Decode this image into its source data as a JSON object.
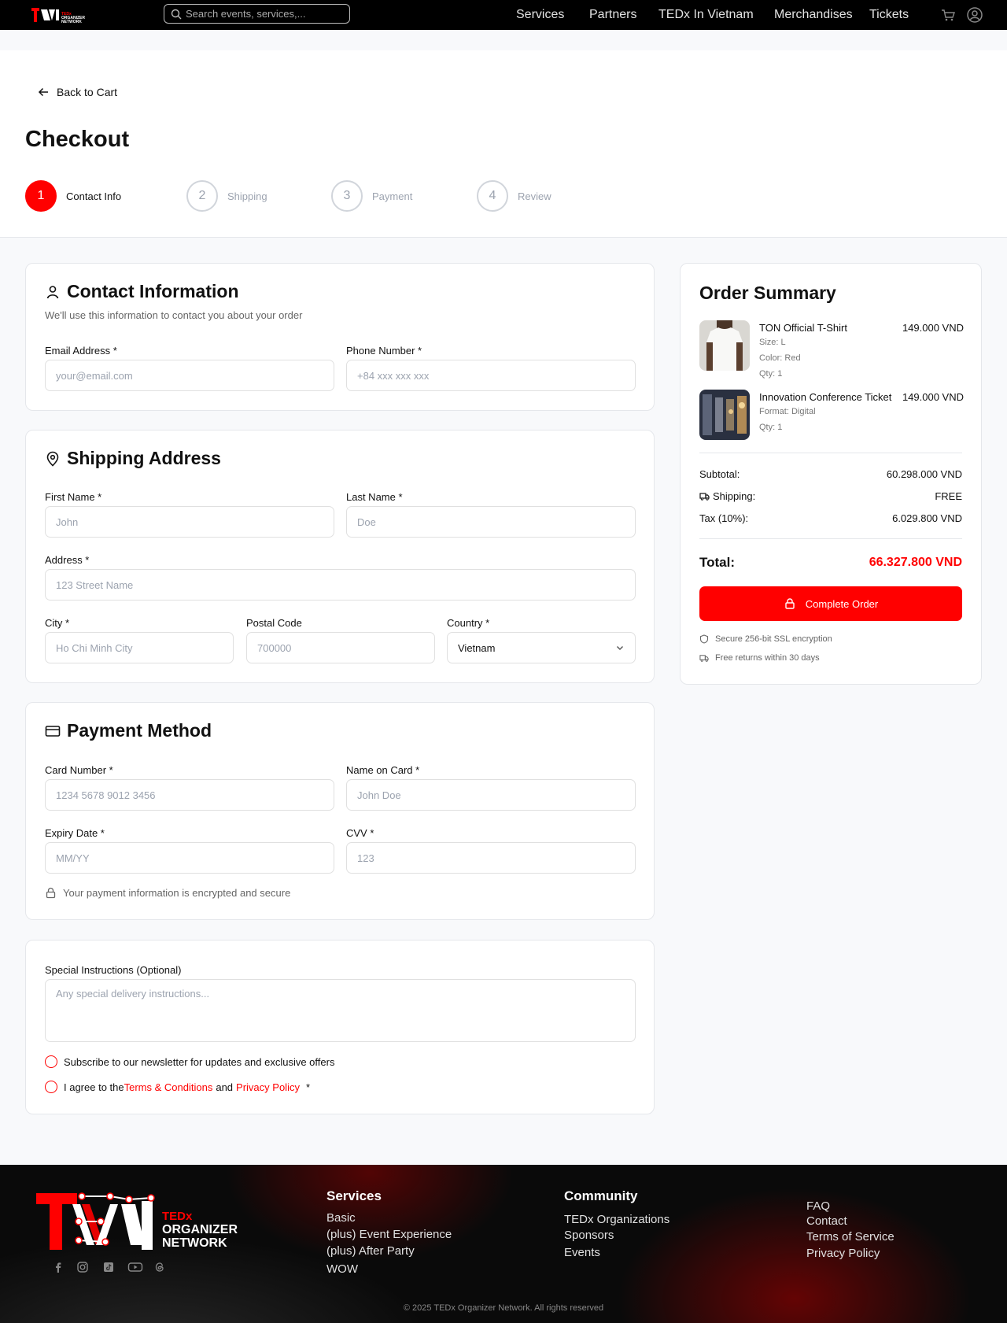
{
  "nav": {
    "logo_text": "TEDx ORGANIZER NETWORK",
    "search_placeholder": "Search events, services,...",
    "links": [
      "Services",
      "Partners",
      "TEDx In Vietnam",
      "Merchandises",
      "Tickets"
    ],
    "icons": [
      "cart-icon",
      "user-icon"
    ]
  },
  "header": {
    "back_label": "Back to Cart",
    "title": "Checkout",
    "steps": [
      {
        "num": "1",
        "label": "Contact Info",
        "active": true
      },
      {
        "num": "2",
        "label": "Shipping",
        "active": false
      },
      {
        "num": "3",
        "label": "Payment",
        "active": false
      },
      {
        "num": "4",
        "label": "Review",
        "active": false
      }
    ]
  },
  "contact": {
    "title": "Contact Information",
    "subtitle": "We'll use this information to contact you about your order",
    "email_label": "Email Address *",
    "email_placeholder": "your@email.com",
    "phone_label": "Phone Number *",
    "phone_placeholder": "+84 xxx xxx xxx"
  },
  "shipping": {
    "title": "Shipping Address",
    "first_label": "First Name *",
    "first_placeholder": "John",
    "last_label": "Last Name *",
    "last_placeholder": "Doe",
    "address_label": "Address *",
    "address_placeholder": "123 Street Name",
    "city_label": "City *",
    "city_placeholder": "Ho Chi Minh City",
    "postal_label": "Postal Code",
    "postal_placeholder": "700000",
    "country_label": "Country *",
    "country_value": "Vietnam"
  },
  "payment": {
    "title": "Payment Method",
    "card_label": "Card Number *",
    "card_placeholder": "1234 5678 9012 3456",
    "name_label": "Name on Card *",
    "name_placeholder": "John Doe",
    "expiry_label": "Expiry Date *",
    "expiry_placeholder": "MM/YY",
    "cvv_label": "CVV *",
    "cvv_placeholder": "123",
    "secure_note": "Your payment information is encrypted and secure"
  },
  "extras": {
    "instructions_label": "Special Instructions (Optional)",
    "instructions_placeholder": "Any special delivery instructions...",
    "newsletter_label": "Subscribe to our newsletter for updates and exclusive offers",
    "agree_prefix": "I agree to the",
    "terms_link": "Terms & Conditions",
    "agree_and": "and",
    "privacy_link": "Privacy Policy",
    "agree_suffix": "*"
  },
  "summary": {
    "title": "Order Summary",
    "items": [
      {
        "name": "TON Official T-Shirt",
        "price": "149.000 VND",
        "meta": [
          "Size: L",
          "Color: Red",
          "Qty: 1"
        ]
      },
      {
        "name": "Innovation Conference Ticket",
        "price": "149.000 VND",
        "meta": [
          "Format: Digital",
          "Qty: 1"
        ]
      }
    ],
    "subtotal_label": "Subtotal:",
    "subtotal_value": "60.298.000 VND",
    "shipping_label": "Shipping:",
    "shipping_value": "FREE",
    "tax_label": "Tax (10%):",
    "tax_value": "6.029.800 VND",
    "total_label": "Total:",
    "total_value": "66.327.800 VND",
    "cta_label": "Complete Order",
    "secure_note": "Secure 256-bit SSL encryption",
    "returns_note": "Free returns within 30 days",
    "accent": "#ff0000"
  },
  "footer": {
    "logo_line1": "TEDx",
    "logo_line2": "ORGANIZER",
    "logo_line3": "NETWORK",
    "services_title": "Services",
    "services": [
      "Basic",
      "(plus) Event Experience",
      "(plus) After Party",
      "WOW"
    ],
    "community_title": "Community",
    "community": [
      "TEDx Organizations",
      "Sponsors",
      "Events"
    ],
    "links": [
      "FAQ",
      "Contact",
      "Terms of Service",
      "Privacy Policy"
    ],
    "social_icons": [
      "facebook-icon",
      "instagram-icon",
      "tiktok-icon",
      "youtube-icon",
      "threads-icon"
    ],
    "copyright": "© 2025 TEDx Organizer Network. All rights reserved"
  }
}
